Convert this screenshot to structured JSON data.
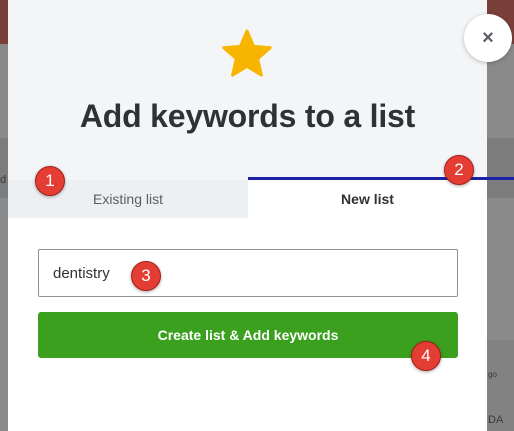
{
  "dialog": {
    "title": "Add keywords to a list",
    "icon": "star-icon",
    "star_color": "#f7b500",
    "close_label": "×"
  },
  "tabs": [
    {
      "label": "Existing list",
      "active": false
    },
    {
      "label": "New list",
      "active": true
    }
  ],
  "form": {
    "list_name_value": "dentistry",
    "submit_label": "Create list & Add keywords"
  },
  "annotations": [
    "1",
    "2",
    "3",
    "4"
  ],
  "background": {
    "edge_text_1": "d",
    "edge_text_2": "go",
    "edge_text_3": "DA"
  },
  "colors": {
    "accent_tab": "#1c21a8",
    "primary_button": "#3aa01e",
    "marker": "#e43d33"
  }
}
